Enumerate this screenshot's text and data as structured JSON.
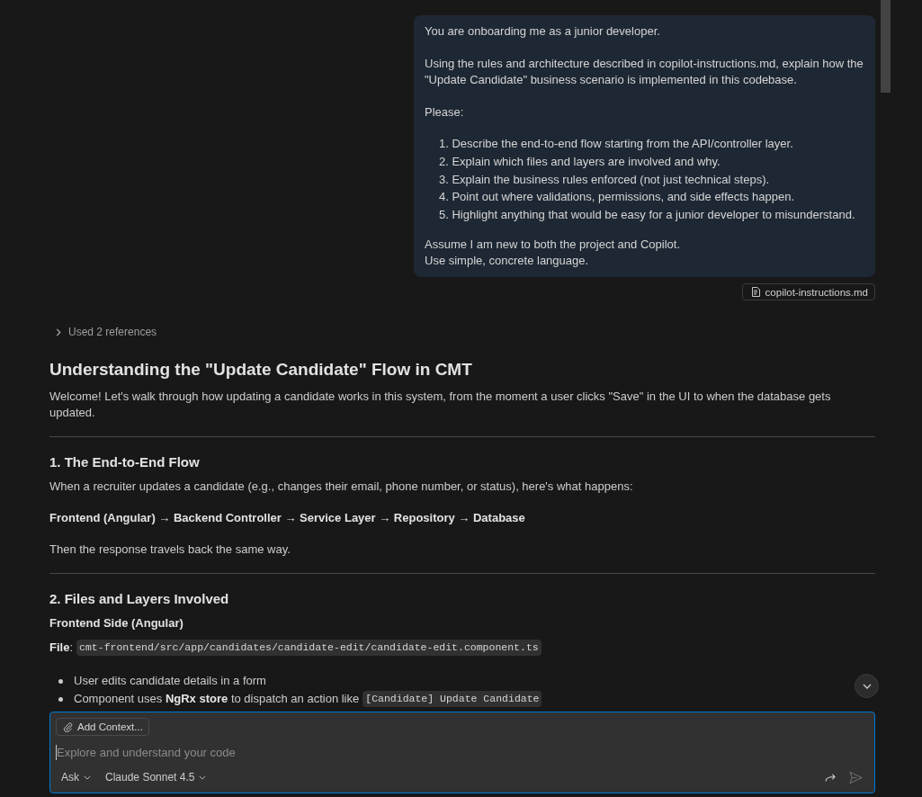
{
  "user_message": {
    "blocks": [
      {
        "kind": "paragraph",
        "text": "You are onboarding me as a junior developer."
      },
      {
        "kind": "paragraph",
        "text": "Using the rules and architecture described in copilot-instructions.md, explain how the \"Update Candidate\" business scenario is implemented in this codebase."
      },
      {
        "kind": "paragraph",
        "text": "Please:"
      },
      {
        "kind": "ordered_list",
        "items": [
          "1. Describe the end-to-end flow starting from the API/controller layer.",
          "2. Explain which files and layers are involved and why.",
          "3. Explain the business rules enforced (not just technical steps).",
          "4. Point out where validations, permissions, and side effects happen.",
          "5. Highlight anything that would be easy for a junior developer to misunderstand."
        ]
      },
      {
        "kind": "lines",
        "lines": [
          "Assume I am new to both the project and Copilot.",
          "Use simple, concrete language."
        ]
      }
    ]
  },
  "attachment": {
    "label": "copilot-instructions.md"
  },
  "references": {
    "label": "Used 2 references",
    "expanded": false
  },
  "response": {
    "title": "Understanding the \"Update Candidate\" Flow in CMT",
    "blocks": [
      {
        "kind": "paragraph",
        "text": "Welcome! Let's walk through how updating a candidate works in this system, from the moment a user clicks \"Save\" in the UI to when the database gets updated."
      },
      {
        "kind": "rule"
      },
      {
        "kind": "heading",
        "text": "1. The End-to-End Flow"
      },
      {
        "kind": "paragraph",
        "text": "When a recruiter updates a candidate (e.g., changes their email, phone number, or status), here's what happens:"
      },
      {
        "kind": "strong",
        "text": "Frontend (Angular) → Backend Controller → Service Layer → Repository → Database"
      },
      {
        "kind": "paragraph",
        "text": "Then the response travels back the same way."
      },
      {
        "kind": "rule"
      },
      {
        "kind": "heading",
        "text": "2. Files and Layers Involved"
      },
      {
        "kind": "subheading",
        "text": "Frontend Side (Angular)"
      },
      {
        "kind": "file",
        "label": "**File**:",
        "code": "cmt-frontend/src/app/candidates/candidate-edit/candidate-edit.component.ts"
      },
      {
        "kind": "bullets",
        "items": [
          {
            "text": "User edits candidate details in a form"
          },
          {
            "text": "Component uses **NgRx store** to dispatch an action like",
            "code": "[Candidate] Update Candidate"
          }
        ]
      }
    ]
  },
  "chat_input": {
    "add_context": "Add Context...",
    "placeholder": "Explore and understand your code",
    "focused": true,
    "mode": "Ask",
    "model": "Claude Sonnet 4.5",
    "send_disabled": true
  }
}
